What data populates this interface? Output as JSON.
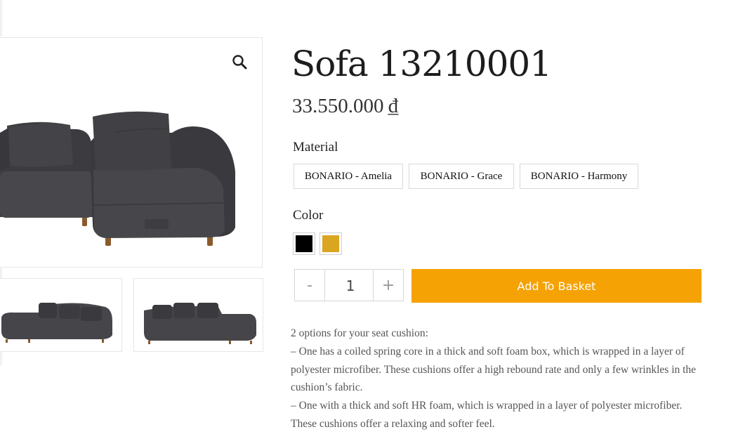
{
  "product": {
    "title": "Sofa 13210001",
    "price": "33.550.000",
    "currency": "₫"
  },
  "material": {
    "label": "Material",
    "options": [
      "BONARIO - Amelia",
      "BONARIO - Grace",
      "BONARIO - Harmony"
    ]
  },
  "color": {
    "label": "Color",
    "options": [
      {
        "name": "black",
        "hex": "#000000"
      },
      {
        "name": "mustard",
        "hex": "#daa520"
      }
    ]
  },
  "quantity": {
    "minus": "-",
    "value": "1",
    "plus": "+"
  },
  "cart": {
    "add_label": "Add To Basket"
  },
  "description": {
    "lines": [
      "2 options for your seat cushion:",
      "– One has a coiled spring core in a thick and soft foam box, which is wrapped in a layer of polyester microfiber. These cushions offer a high rebound rate and only a few wrinkles in the cushion’s fabric.",
      "– One with a thick and soft HR foam, which is wrapped in a layer of polyester microfiber. These cushions offer a relaxing and softer feel."
    ]
  },
  "icons": {
    "zoom": "magnifier-icon"
  }
}
